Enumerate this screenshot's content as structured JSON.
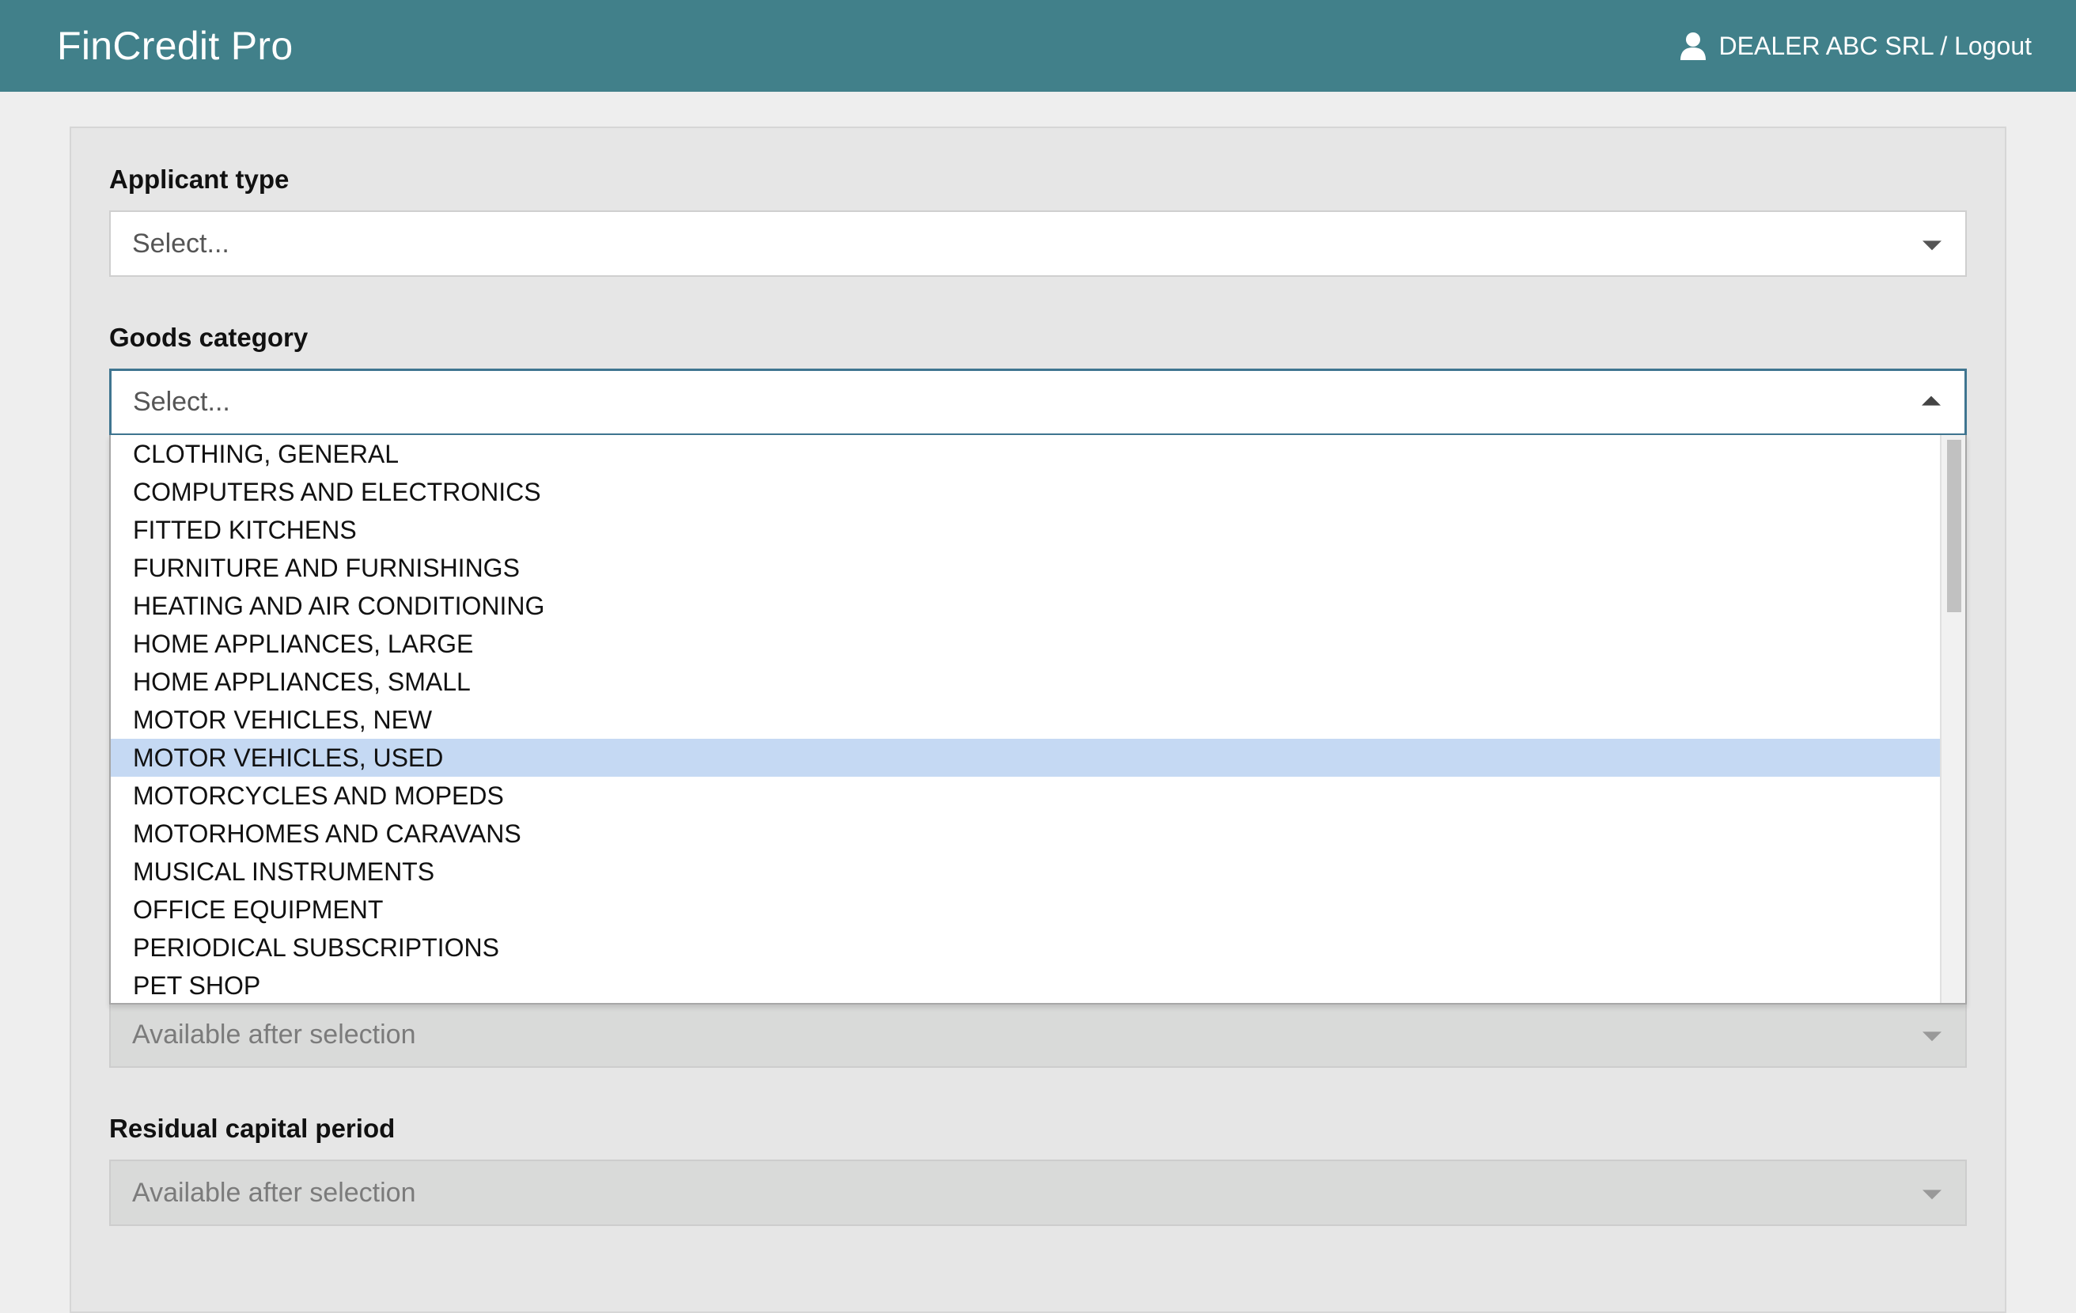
{
  "app": {
    "title": "FinCredit Pro"
  },
  "header": {
    "user_text": "DEALER ABC SRL / Logout",
    "user_icon": "user-icon"
  },
  "form": {
    "applicant_type": {
      "label": "Applicant type",
      "placeholder": "Select..."
    },
    "goods_category": {
      "label": "Goods category",
      "placeholder": "Select...",
      "options": [
        "CLOTHING, GENERAL",
        "COMPUTERS AND ELECTRONICS",
        "FITTED KITCHENS",
        "FURNITURE AND FURNISHINGS",
        "HEATING AND AIR CONDITIONING",
        "HOME APPLIANCES, LARGE",
        "HOME APPLIANCES, SMALL",
        "MOTOR VEHICLES, NEW",
        "MOTOR VEHICLES, USED",
        "MOTORCYCLES AND MOPEDS",
        "MOTORHOMES AND CARAVANS",
        "MUSICAL INSTRUMENTS",
        "OFFICE EQUIPMENT",
        "PERIODICAL SUBSCRIPTIONS",
        "PET SHOP"
      ],
      "highlighted": "MOTOR VEHICLES, USED"
    },
    "hidden_field": {
      "placeholder": "Available after selection"
    },
    "residual_capital_period": {
      "label": "Residual capital period",
      "placeholder": "Available after selection"
    }
  },
  "colors": {
    "header": "#41808a",
    "highlight": "#c5d9f3",
    "focus_border": "#3f7590"
  }
}
